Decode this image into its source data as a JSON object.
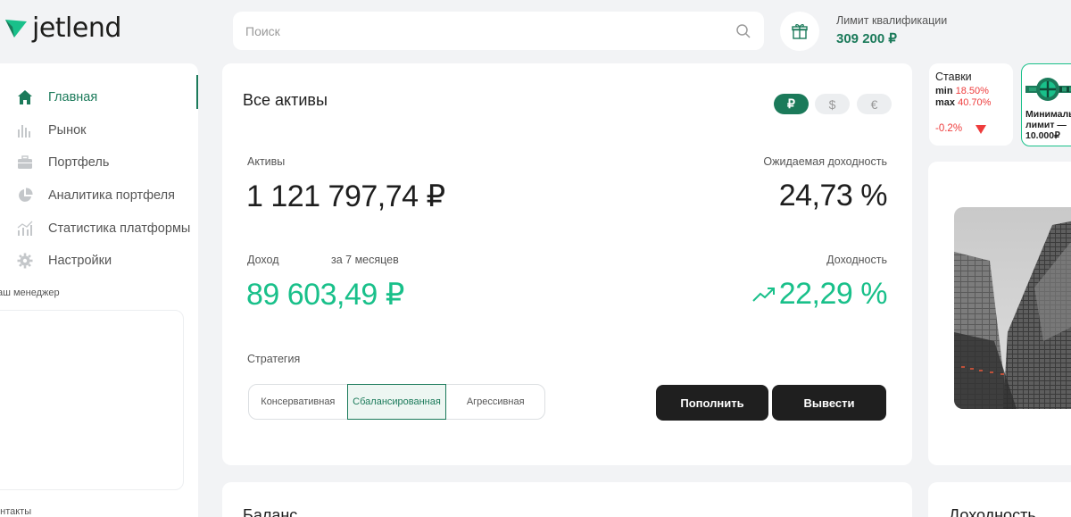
{
  "header": {
    "logo_text": "jetlend",
    "search_placeholder": "Поиск",
    "limit_label": "Лимит квалификации",
    "limit_value": "309 200 ₽"
  },
  "sidebar": {
    "items": [
      {
        "label": "Главная",
        "icon": "home-icon",
        "active": true
      },
      {
        "label": "Рынок",
        "icon": "bar-chart-icon"
      },
      {
        "label": "Портфель",
        "icon": "briefcase-icon"
      },
      {
        "label": "Аналитика портфеля",
        "icon": "pie-chart-icon"
      },
      {
        "label": "Статистика платформы",
        "icon": "stats-icon"
      },
      {
        "label": "Настройки",
        "icon": "gear-icon"
      }
    ],
    "manager_label": "аш менеджер",
    "contacts_label": "онтакты"
  },
  "main": {
    "title": "Все активы",
    "currencies": [
      "₽",
      "$",
      "€"
    ],
    "active_currency": "₽",
    "assets_label": "Активы",
    "assets_value": "1 121 797,74 ₽",
    "expected_yield_label": "Ожидаемая доходность",
    "expected_yield_value": "24,73 %",
    "income_label": "Доход",
    "income_period": "за 7 месяцев",
    "income_value": "89 603,49 ₽",
    "yield_label": "Доходность",
    "yield_value": "22,29 %",
    "strategy_label": "Стратегия",
    "strategies": [
      "Консервативная",
      "Сбалансированная",
      "Агрессивная"
    ],
    "active_strategy": "Сбалансированная",
    "deposit_label": "Пополнить",
    "withdraw_label": "Вывести"
  },
  "rates": {
    "title": "Ставки",
    "min_label": "min",
    "min_value": "18.50%",
    "max_label": "max",
    "max_value": "40.70%",
    "change": "-0.2%"
  },
  "promo": {
    "line1": "Минимальн",
    "line2": "лимит —",
    "line3": "10.000₽"
  },
  "bottom": {
    "balance_title": "Баланс",
    "yield_title": "Доходность"
  },
  "colors": {
    "brand": "#1b7a5a",
    "accent_green": "#19c08a",
    "red": "#ee3c3c",
    "dark_button": "#1f1f1f"
  }
}
